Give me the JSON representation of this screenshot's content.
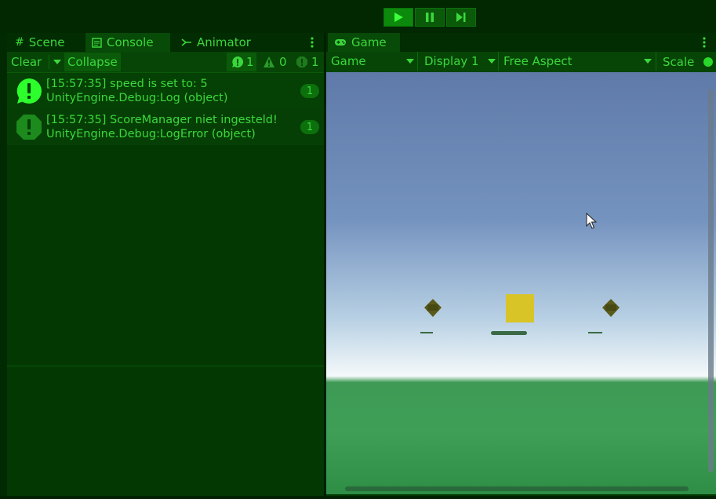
{
  "toolbar": {
    "play_icon": "play-icon",
    "pause_icon": "pause-icon",
    "step_icon": "step-icon"
  },
  "left_panel": {
    "tabs": [
      {
        "label": "Scene",
        "icon": "grid-icon"
      },
      {
        "label": "Console",
        "icon": "console-icon"
      },
      {
        "label": "Animator",
        "icon": "animator-icon"
      }
    ],
    "toolbar": {
      "clear_label": "Clear",
      "collapse_label": "Collapse",
      "info_count": "1",
      "warning_count": "0",
      "error_count": "1"
    },
    "logs": [
      {
        "line1": "[15:57:35] speed is set to: 5",
        "line2": "UnityEngine.Debug:Log (object)",
        "count": "1",
        "type": "info"
      },
      {
        "line1": "[15:57:35] ScoreManager niet ingesteld!",
        "line2": "UnityEngine.Debug:LogError (object)",
        "count": "1",
        "type": "error"
      }
    ]
  },
  "game_panel": {
    "tab_label": "Game",
    "tab_icon": "gamepad-icon",
    "view_select": "Game",
    "display_select": "Display 1",
    "aspect_select": "Free Aspect",
    "scale_label": "Scale"
  },
  "colors": {
    "accent": "#3bd83b",
    "panel": "#033803",
    "sky_top": "#5f7aa8",
    "ground": "#3f9f56",
    "cube": "#d9c427"
  }
}
